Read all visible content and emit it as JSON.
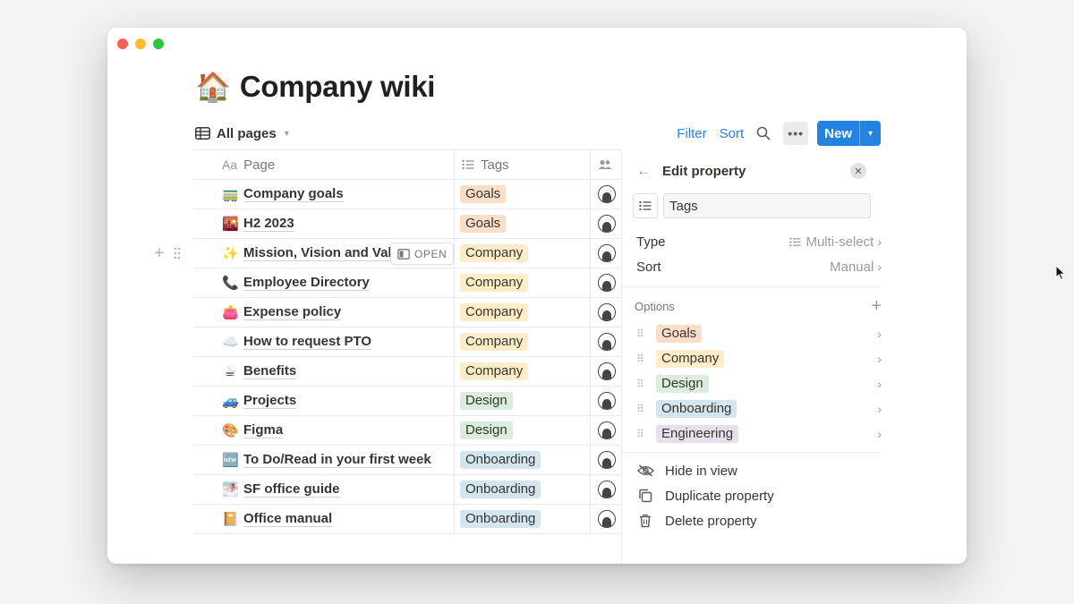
{
  "page": {
    "icon": "🏠",
    "title": "Company wiki"
  },
  "view": {
    "icon": "table-icon",
    "label": "All pages"
  },
  "toolbar": {
    "filter": "Filter",
    "sort": "Sort",
    "more": "•••",
    "new": "New"
  },
  "table": {
    "columns": [
      {
        "label": "Page",
        "prefix": "Aa"
      },
      {
        "label": "Tags"
      },
      {
        "label": ""
      }
    ],
    "rows": [
      {
        "icon": "🚃",
        "title": "Company goals",
        "tag": "Goals"
      },
      {
        "icon": "🌇",
        "title": "H2 2023",
        "tag": "Goals"
      },
      {
        "icon": "✨",
        "title": "Mission, Vision and Value",
        "tag": "Company"
      },
      {
        "icon": "📞",
        "title": "Employee Directory",
        "tag": "Company"
      },
      {
        "icon": "👛",
        "title": "Expense policy",
        "tag": "Company"
      },
      {
        "icon": "☁️",
        "title": "How to request PTO",
        "tag": "Company"
      },
      {
        "icon": "☕",
        "title": "Benefits",
        "tag": "Company"
      },
      {
        "icon": "🚙",
        "title": "Projects",
        "tag": "Design"
      },
      {
        "icon": "🎨",
        "title": "Figma",
        "tag": "Design"
      },
      {
        "icon": "🆕",
        "title": "To Do/Read in your first week",
        "tag": "Onboarding"
      },
      {
        "icon": "🌁",
        "title": "SF office guide",
        "tag": "Onboarding"
      },
      {
        "icon": "📔",
        "title": "Office manual",
        "tag": "Onboarding"
      }
    ],
    "open_label": "OPEN"
  },
  "tag_colors": {
    "Goals": "#fadec9",
    "Company": "#fdecc8",
    "Design": "#dbeddb",
    "Onboarding": "#d3e5ef",
    "Engineering": "#e8deee"
  },
  "panel": {
    "title": "Edit property",
    "name_value": "Tags",
    "type_label": "Type",
    "type_value": "Multi-select",
    "sort_label": "Sort",
    "sort_value": "Manual",
    "options_label": "Options",
    "options": [
      "Goals",
      "Company",
      "Design",
      "Onboarding",
      "Engineering"
    ],
    "actions": [
      {
        "icon": "eye-slash-icon",
        "label": "Hide in view"
      },
      {
        "icon": "duplicate-icon",
        "label": "Duplicate property"
      },
      {
        "icon": "trash-icon",
        "label": "Delete property"
      }
    ]
  }
}
